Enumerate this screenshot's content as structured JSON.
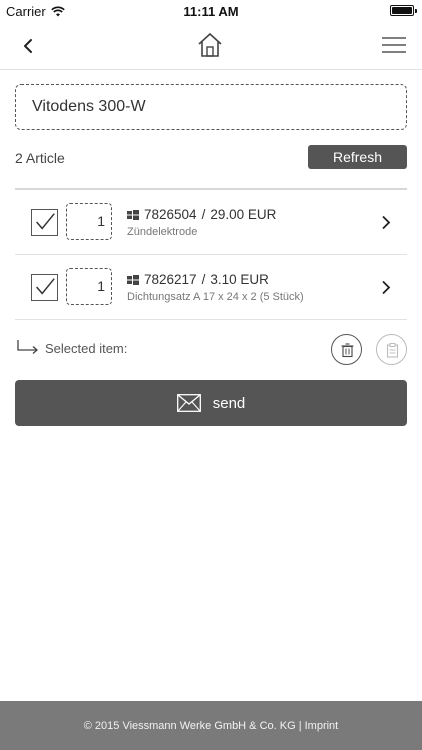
{
  "status_bar": {
    "carrier": "Carrier",
    "time": "11:11 AM",
    "wifi_icon": "wifi-icon",
    "battery_icon": "battery-icon"
  },
  "nav": {
    "back_icon": "chevron-left-icon",
    "home_icon": "home-icon",
    "menu_icon": "hamburger-menu-icon"
  },
  "search": {
    "value": "Vitodens 300-W"
  },
  "article_count": "2 Article",
  "refresh_label": "Refresh",
  "items": [
    {
      "checked": true,
      "quantity": "1",
      "article_no": "7826504",
      "separator": "/",
      "price": "29.00 EUR",
      "description": "Zündelektrode"
    },
    {
      "checked": true,
      "quantity": "1",
      "article_no": "7826217",
      "separator": "/",
      "price": "3.10 EUR",
      "description": "Dichtungsatz A 17 x 24 x 2 (5 Stück)"
    }
  ],
  "selected_label": "Selected item:",
  "send_label": "send",
  "footer": "© 2015 Viessmann Werke GmbH & Co. KG | Imprint",
  "colors": {
    "button_dark": "#555555",
    "footer_bg": "#7a7a7a",
    "divider": "#e2e2e2"
  }
}
